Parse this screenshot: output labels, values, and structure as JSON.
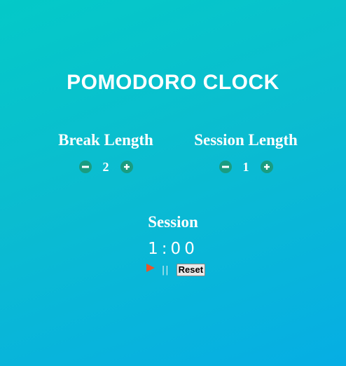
{
  "app": {
    "title": "POMODORO CLOCK"
  },
  "break": {
    "label": "Break Length",
    "value": "2",
    "decrement_icon": "minus-circle-icon",
    "increment_icon": "plus-circle-icon"
  },
  "session": {
    "label": "Session Length",
    "value": "1",
    "decrement_icon": "minus-circle-icon",
    "increment_icon": "plus-circle-icon"
  },
  "timer": {
    "label": "Session",
    "display": "1:00",
    "play_icon": "play-icon",
    "pause_label": "||",
    "reset_label": "Reset"
  },
  "colors": {
    "background_start": "#04c9c8",
    "background_end": "#06aee4",
    "text": "#ffffff",
    "control_button": "#1a9c80",
    "play": "#e8552a"
  }
}
